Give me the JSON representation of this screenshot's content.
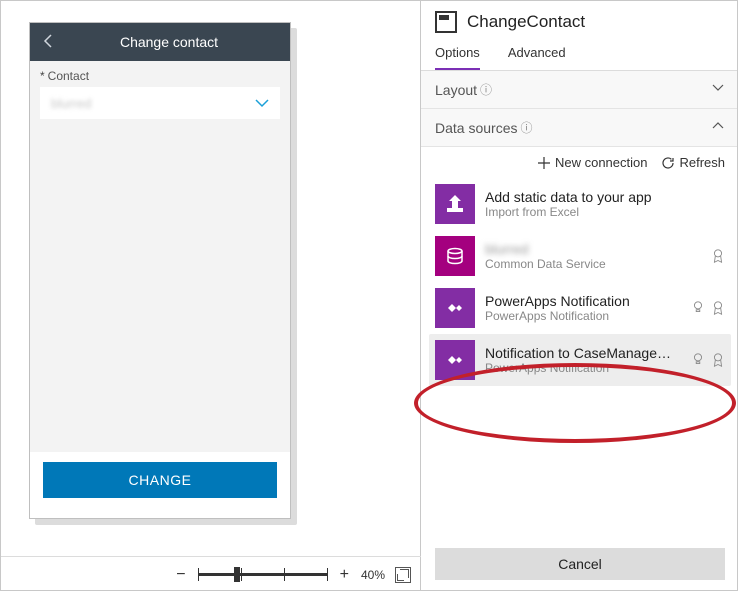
{
  "colors": {
    "accent": "#7b2fb5",
    "primary_button": "#0078b8",
    "icon_purple": "#832da4",
    "icon_magenta": "#a4007f",
    "highlight": "#c2202a"
  },
  "canvas": {
    "screen_title": "Change contact",
    "field_label": "Contact",
    "dropdown_value": "blurred",
    "button_label": "CHANGE"
  },
  "zoom": {
    "minus": "−",
    "plus": "+",
    "percent": "40%"
  },
  "panel": {
    "title": "ChangeContact",
    "tabs": {
      "options": "Options",
      "advanced": "Advanced"
    },
    "sections": {
      "layout": "Layout",
      "data_sources": "Data sources"
    },
    "actions": {
      "new_connection": "New connection",
      "refresh": "Refresh"
    },
    "items": [
      {
        "title": "Add static data to your app",
        "sub": "Import from Excel"
      },
      {
        "title": "blurred",
        "sub": "Common Data Service"
      },
      {
        "title": "PowerApps Notification",
        "sub": "PowerApps Notification"
      },
      {
        "title": "Notification to CaseManageme…",
        "sub": "PowerApps Notification"
      }
    ],
    "cancel": "Cancel"
  }
}
